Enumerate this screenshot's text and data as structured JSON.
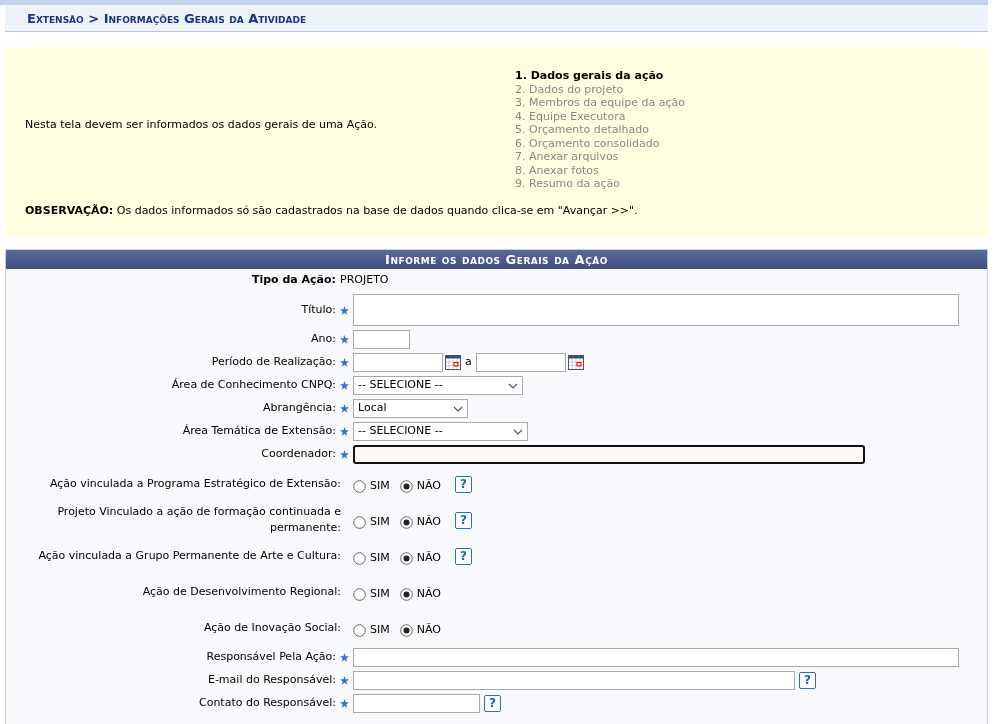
{
  "breadcrumb": "Extensão > Informações Gerais da Atividade",
  "instructions": {
    "text": "Nesta tela devem ser informados os dados gerais de uma Ação.",
    "steps": [
      {
        "label": "1. Dados gerais da ação",
        "selected": true
      },
      {
        "label": "2. Dados do projeto",
        "selected": false
      },
      {
        "label": "3. Membros da equipe da ação",
        "selected": false
      },
      {
        "label": "4. Equipe Executora",
        "selected": false
      },
      {
        "label": "5. Orçamento detalhado",
        "selected": false
      },
      {
        "label": "6. Orçamento consolidado",
        "selected": false
      },
      {
        "label": "7. Anexar arquivos",
        "selected": false
      },
      {
        "label": "8. Anexar fotos",
        "selected": false
      },
      {
        "label": "9. Resumo da ação",
        "selected": false
      }
    ],
    "note": "**OBSERVAÇÃO:** Os dados informados só são cadastrados na base de dados quando clica-se em \"Avançar >>\"."
  },
  "form": {
    "title": "Informe os dados Gerais da Ação",
    "fields": [
      {
        "kind": "static",
        "label": "Tipo da Ação:",
        "value": "PROJETO",
        "required": false
      },
      {
        "kind": "textarea",
        "label": "Título:",
        "required": true
      },
      {
        "kind": "year",
        "label": "Ano:",
        "required": true
      },
      {
        "kind": "daterange",
        "label": "Período de Realização:",
        "required": true,
        "separator": "a"
      },
      {
        "kind": "select",
        "label": "Área de Conhecimento CNPQ:",
        "required": true,
        "value": "-- SELECIONE --"
      },
      {
        "kind": "select",
        "label": "Abrangência:",
        "required": true,
        "value": "Local"
      },
      {
        "kind": "select",
        "label": "Área Temática de Extensão:",
        "required": true,
        "value": "-- SELECIONE --"
      },
      {
        "kind": "autocomplete",
        "label": "Coordenador:",
        "required": true,
        "focused": true
      },
      {
        "kind": "radio",
        "label": "Ação vinculada a Programa Estratégico de Extensão:",
        "options": [
          {
            "label": "SIM",
            "selected": false
          },
          {
            "label": "NÃO",
            "selected": true
          }
        ],
        "help": "?"
      },
      {
        "kind": "radio",
        "label": "Projeto Vinculado a ação de formação continuada e permanente:",
        "options": [
          {
            "label": "SIM",
            "selected": false
          },
          {
            "label": "NÃO",
            "selected": true
          }
        ],
        "help": "?"
      },
      {
        "kind": "radio",
        "label": "Ação vinculada a Grupo Permanente de Arte e Cultura:",
        "options": [
          {
            "label": "SIM",
            "selected": false
          },
          {
            "label": "NÃO",
            "selected": true
          }
        ],
        "help": "?"
      },
      {
        "kind": "radio",
        "label": "Ação de Desenvolvimento Regional:",
        "options": [
          {
            "label": "SIM",
            "selected": false
          },
          {
            "label": "NÃO",
            "selected": true
          }
        ]
      },
      {
        "kind": "radio",
        "label": "Ação de Inovação Social:",
        "options": [
          {
            "label": "SIM",
            "selected": false
          },
          {
            "label": "NÃO",
            "selected": true
          }
        ]
      },
      {
        "kind": "text",
        "label": "Responsável Pela Ação:",
        "required": true
      },
      {
        "kind": "email",
        "label": "E-mail do Responsável:",
        "required": true,
        "help": "?"
      },
      {
        "kind": "phone",
        "label": "Contato do Responsável:",
        "required": true,
        "help": "?"
      }
    ]
  }
}
